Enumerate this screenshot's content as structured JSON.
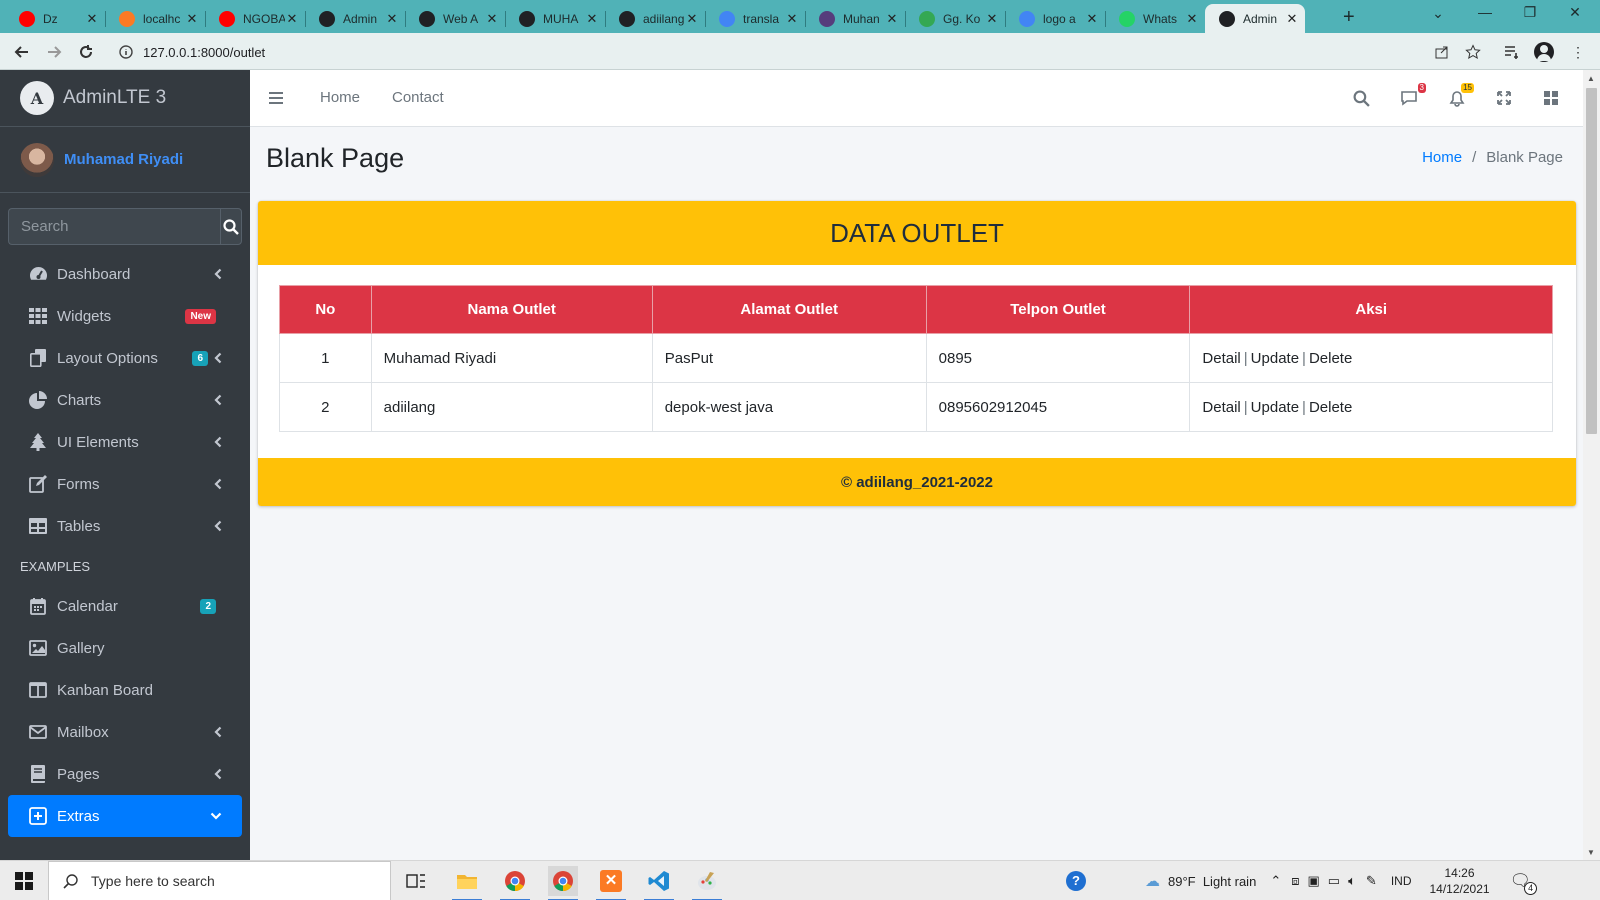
{
  "browser": {
    "tabs": [
      {
        "title": "Dz",
        "favicon": "youtube-icon",
        "color": "#ff0000"
      },
      {
        "title": "localhc",
        "favicon": "xampp-icon",
        "color": "#fb7a24"
      },
      {
        "title": "NGOBA",
        "favicon": "youtube-icon",
        "color": "#ff0000"
      },
      {
        "title": "Admin",
        "favicon": "globe-icon",
        "color": "#202124"
      },
      {
        "title": "Web A",
        "favicon": "globe-icon",
        "color": "#202124"
      },
      {
        "title": "MUHA",
        "favicon": "globe-icon",
        "color": "#202124"
      },
      {
        "title": "adiilang",
        "favicon": "globe-icon",
        "color": "#202124"
      },
      {
        "title": "transla",
        "favicon": "google-icon",
        "color": "#4285f4"
      },
      {
        "title": "Muhan",
        "favicon": "bootstrap-icon",
        "color": "#563d7c"
      },
      {
        "title": "Gg. Ko",
        "favicon": "maps-icon",
        "color": "#34a853"
      },
      {
        "title": "logo a",
        "favicon": "google-icon",
        "color": "#4285f4"
      },
      {
        "title": "Whats",
        "favicon": "whatsapp-icon",
        "color": "#25d366"
      },
      {
        "title": "Admin",
        "favicon": "globe-icon",
        "color": "#202124",
        "active": true
      }
    ],
    "url": "127.0.0.1:8000/outlet"
  },
  "sidebar": {
    "brand": "AdminLTE 3",
    "brand_logo_letter": "A",
    "user": "Muhamad Riyadi",
    "search_placeholder": "Search",
    "items": [
      {
        "label": "Dashboard",
        "icon": "tachometer-icon",
        "chevron": true
      },
      {
        "label": "Widgets",
        "icon": "th-icon",
        "badge": "New",
        "badge_color": "#dc3545"
      },
      {
        "label": "Layout Options",
        "icon": "copy-icon",
        "badge": "6",
        "badge_color": "#17a2b8",
        "chevron": true
      },
      {
        "label": "Charts",
        "icon": "pie-chart-icon",
        "chevron": true
      },
      {
        "label": "UI Elements",
        "icon": "tree-icon",
        "chevron": true
      },
      {
        "label": "Forms",
        "icon": "edit-icon",
        "chevron": true
      },
      {
        "label": "Tables",
        "icon": "table-icon",
        "chevron": true
      }
    ],
    "header": "EXAMPLES",
    "examples": [
      {
        "label": "Calendar",
        "icon": "calendar-icon",
        "badge": "2",
        "badge_color": "#17a2b8"
      },
      {
        "label": "Gallery",
        "icon": "image-icon"
      },
      {
        "label": "Kanban Board",
        "icon": "columns-icon"
      },
      {
        "label": "Mailbox",
        "icon": "envelope-icon",
        "chevron": true
      },
      {
        "label": "Pages",
        "icon": "book-icon",
        "chevron": true
      },
      {
        "label": "Extras",
        "icon": "plus-square-icon",
        "active": true
      }
    ]
  },
  "topnav": {
    "home": "Home",
    "contact": "Contact",
    "messages_count": "3",
    "notifications_count": "15"
  },
  "page": {
    "title": "Blank Page",
    "breadcrumb_home": "Home",
    "breadcrumb_sep": "/",
    "breadcrumb_current": "Blank Page"
  },
  "card": {
    "header": "DATA OUTLET",
    "columns": [
      "No",
      "Nama Outlet",
      "Alamat Outlet",
      "Telpon Outlet",
      "Aksi"
    ],
    "rows": [
      {
        "no": "1",
        "nama": "Muhamad Riyadi",
        "alamat": "PasPut",
        "telpon": "0895",
        "detail": "Detail",
        "update": "Update",
        "delete": "Delete"
      },
      {
        "no": "2",
        "nama": "adiilang",
        "alamat": "depok-west java",
        "telpon": "0895602912045",
        "detail": "Detail",
        "update": "Update",
        "delete": "Delete"
      }
    ],
    "action_sep": "|",
    "footer": "© adiilang_2021-2022"
  },
  "taskbar": {
    "search_placeholder": "Type here to search",
    "weather": "89°F  Light rain",
    "language": "IND",
    "time": "14:26",
    "date": "14/12/2021",
    "notification_count": "4"
  },
  "colors": {
    "sidebar_bg": "#343a40",
    "accent": "#007bff",
    "warning": "#ffc107",
    "danger": "#dc3545",
    "tab_strip": "#50b2b7"
  }
}
